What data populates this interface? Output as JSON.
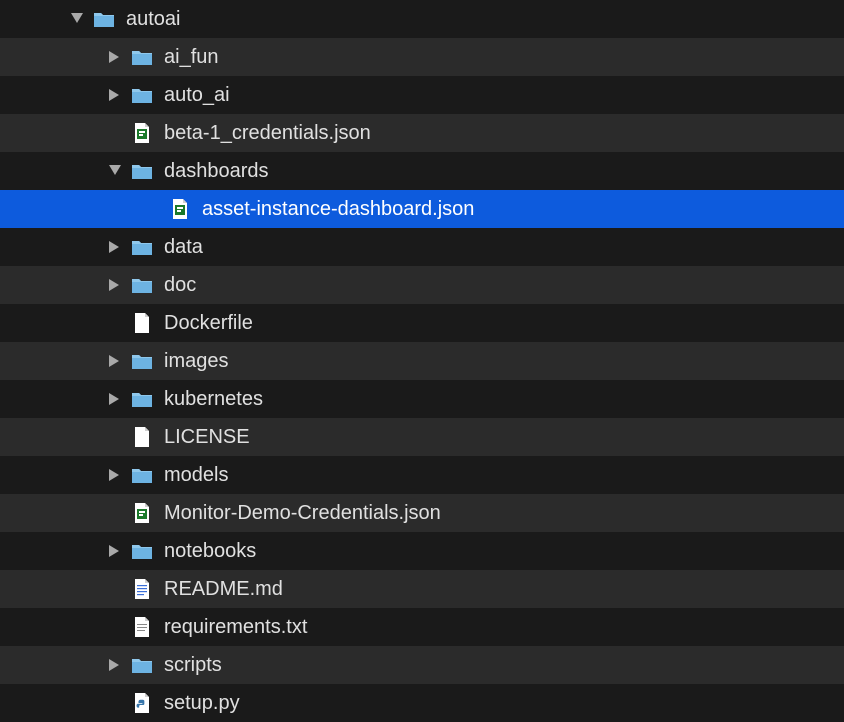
{
  "tree": [
    {
      "label": "autoai",
      "depth": 0,
      "type": "folder",
      "expanded": true,
      "interactable": true
    },
    {
      "label": "ai_fun",
      "depth": 1,
      "type": "folder",
      "expanded": false,
      "interactable": true
    },
    {
      "label": "auto_ai",
      "depth": 1,
      "type": "folder",
      "expanded": false,
      "interactable": true
    },
    {
      "label": "beta-1_credentials.json",
      "depth": 1,
      "type": "json-file",
      "interactable": true
    },
    {
      "label": "dashboards",
      "depth": 1,
      "type": "folder",
      "expanded": true,
      "interactable": true
    },
    {
      "label": "asset-instance-dashboard.json",
      "depth": 2,
      "type": "json-file",
      "selected": true,
      "interactable": true
    },
    {
      "label": "data",
      "depth": 1,
      "type": "folder",
      "expanded": false,
      "interactable": true
    },
    {
      "label": "doc",
      "depth": 1,
      "type": "folder",
      "expanded": false,
      "interactable": true
    },
    {
      "label": "Dockerfile",
      "depth": 1,
      "type": "file",
      "interactable": true
    },
    {
      "label": "images",
      "depth": 1,
      "type": "folder",
      "expanded": false,
      "interactable": true
    },
    {
      "label": "kubernetes",
      "depth": 1,
      "type": "folder",
      "expanded": false,
      "interactable": true
    },
    {
      "label": "LICENSE",
      "depth": 1,
      "type": "file",
      "interactable": true
    },
    {
      "label": "models",
      "depth": 1,
      "type": "folder",
      "expanded": false,
      "interactable": true
    },
    {
      "label": "Monitor-Demo-Credentials.json",
      "depth": 1,
      "type": "json-file",
      "interactable": true
    },
    {
      "label": "notebooks",
      "depth": 1,
      "type": "folder",
      "expanded": false,
      "interactable": true
    },
    {
      "label": "README.md",
      "depth": 1,
      "type": "md-file",
      "interactable": true
    },
    {
      "label": "requirements.txt",
      "depth": 1,
      "type": "txt-file",
      "interactable": true
    },
    {
      "label": "scripts",
      "depth": 1,
      "type": "folder",
      "expanded": false,
      "interactable": true
    },
    {
      "label": "setup.py",
      "depth": 1,
      "type": "py-file",
      "interactable": true
    }
  ],
  "indentBase": 70,
  "indentStep": 38
}
